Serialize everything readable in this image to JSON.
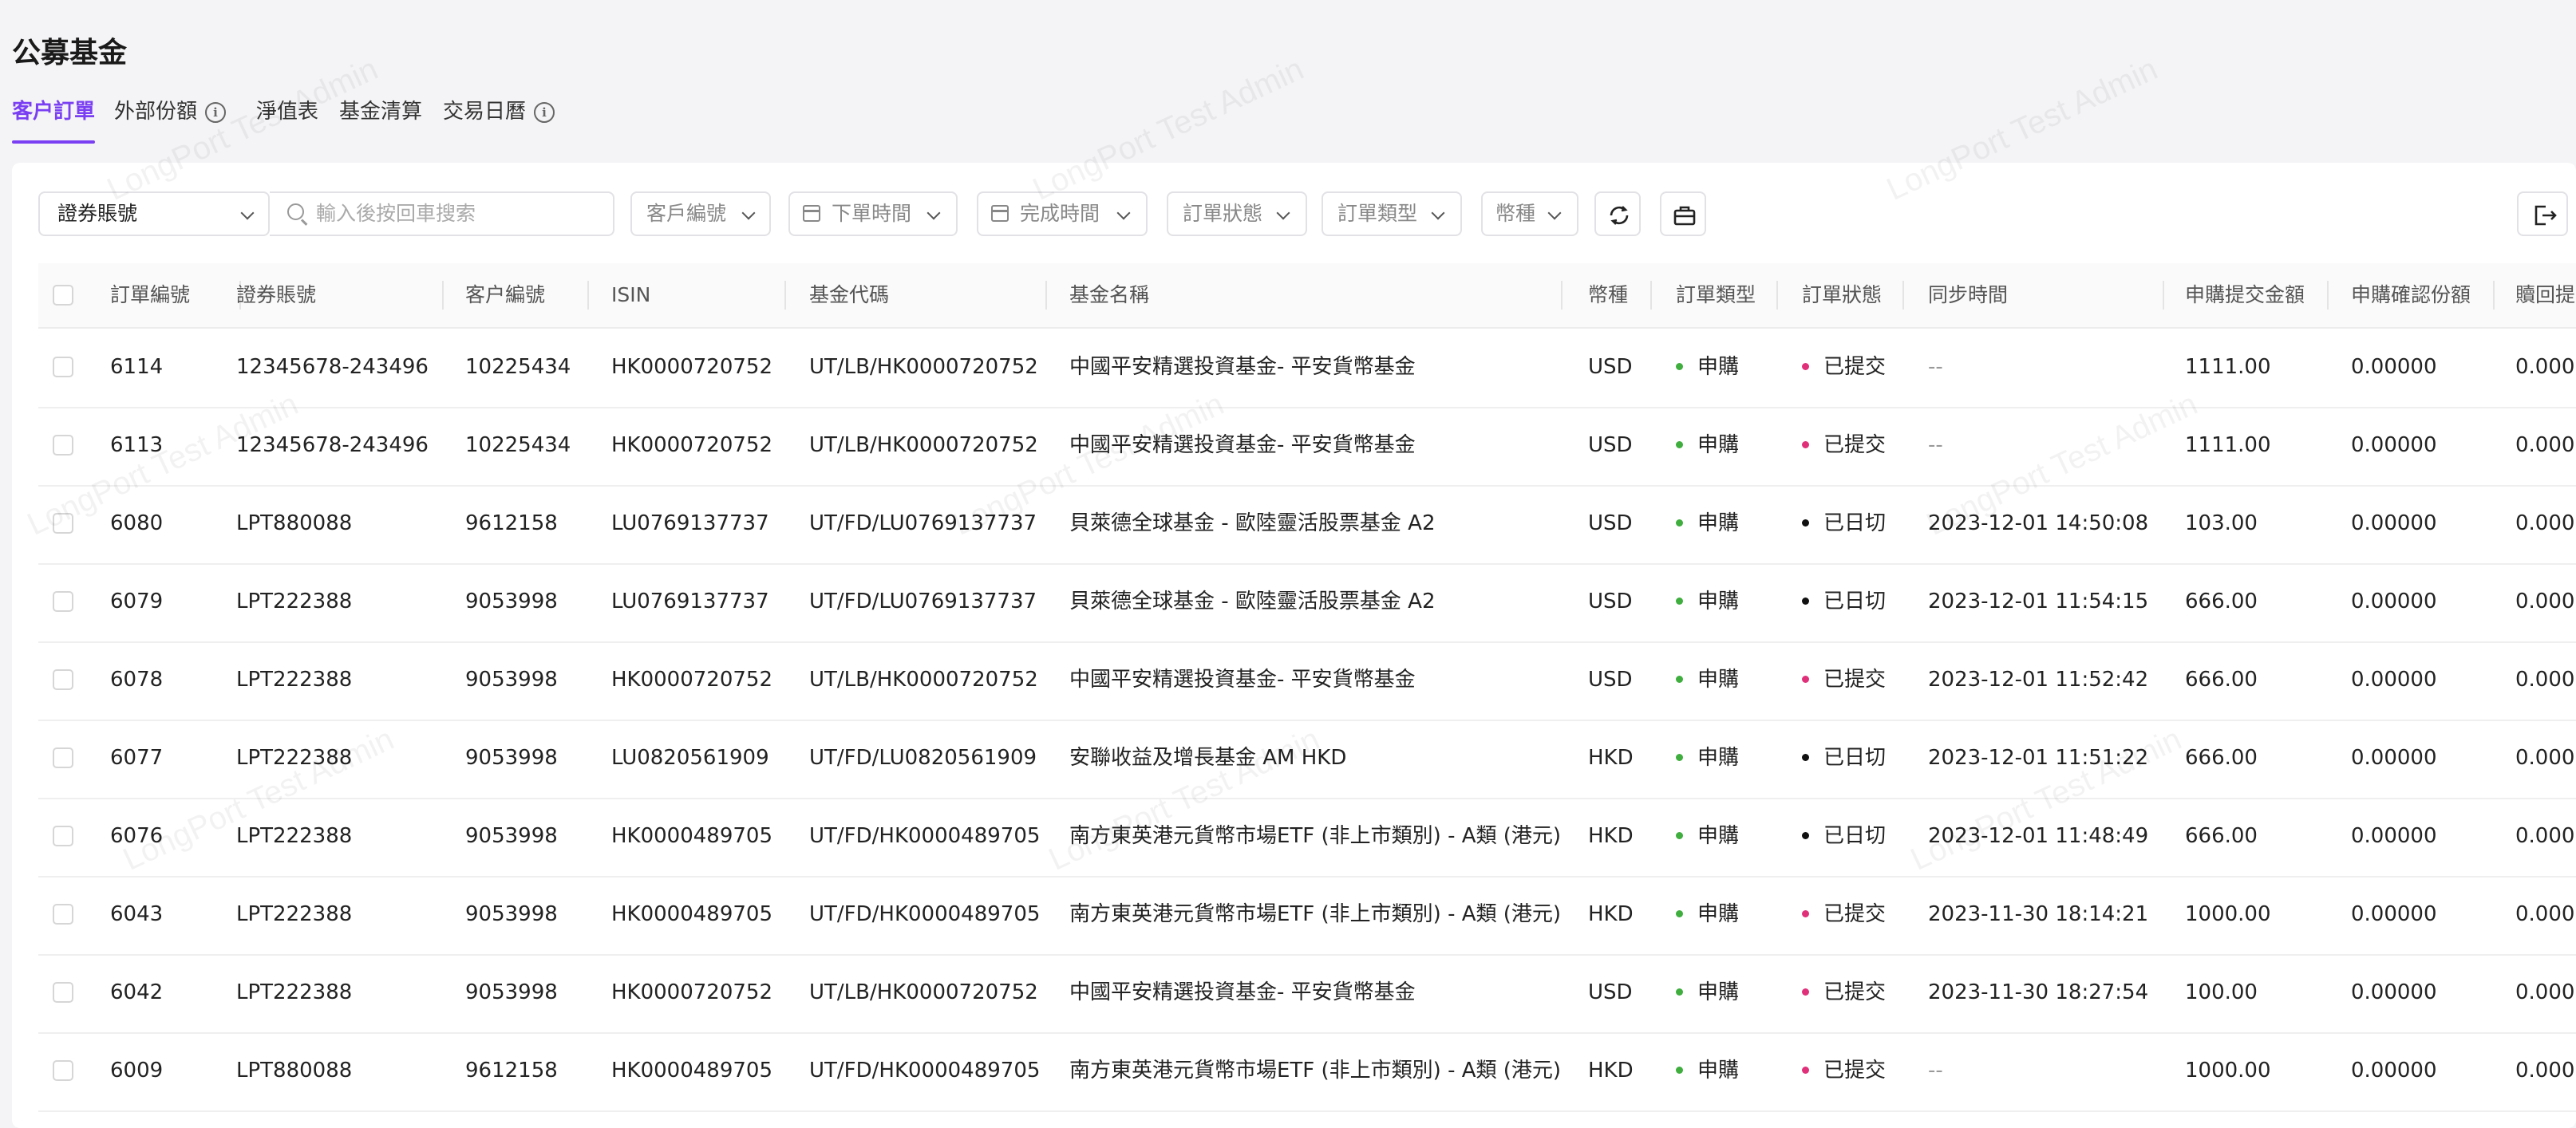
{
  "page": {
    "title": "公募基金"
  },
  "tabs": [
    {
      "label": "客户訂單",
      "active": true
    },
    {
      "label": "外部份額",
      "info": true
    },
    {
      "label": "淨值表"
    },
    {
      "label": "基金清算"
    },
    {
      "label": "交易日曆",
      "info": true
    }
  ],
  "filters": {
    "account_select": "證券賬號",
    "search_placeholder": "輸入後按回車搜索",
    "customer_no": "客戶編號",
    "order_time": "下單時間",
    "complete_time": "完成時間",
    "order_status": "訂單狀態",
    "order_type": "訂單類型",
    "currency": "幣種"
  },
  "columns": [
    "訂單編號",
    "證券賬號",
    "客户編號",
    "ISIN",
    "基金代碼",
    "基金名稱",
    "幣種",
    "訂單類型",
    "訂單狀態",
    "同步時間",
    "申購提交金額",
    "申購確認份額",
    "贖回提"
  ],
  "status_colors": {
    "已提交": "#e0307a",
    "已日切": "#111111",
    "申購": "#3fae3f"
  },
  "accent_color": "#7a3ff2",
  "rows": [
    {
      "order_no": "6114",
      "account": "12345678-243496",
      "customer": "10225434",
      "isin": "HK0000720752",
      "fund_code": "UT/LB/HK0000720752",
      "fund_name": "中國平安精選投資基金- 平安貨幣基金",
      "currency": "USD",
      "type": "申購",
      "status": "已提交",
      "sync_time": "--",
      "amount": "1111.00",
      "confirmed": "0.00000",
      "redeem": "0.000"
    },
    {
      "order_no": "6113",
      "account": "12345678-243496",
      "customer": "10225434",
      "isin": "HK0000720752",
      "fund_code": "UT/LB/HK0000720752",
      "fund_name": "中國平安精選投資基金- 平安貨幣基金",
      "currency": "USD",
      "type": "申購",
      "status": "已提交",
      "sync_time": "--",
      "amount": "1111.00",
      "confirmed": "0.00000",
      "redeem": "0.000"
    },
    {
      "order_no": "6080",
      "account": "LPT880088",
      "customer": "9612158",
      "isin": "LU0769137737",
      "fund_code": "UT/FD/LU0769137737",
      "fund_name": "貝萊德全球基金 - 歐陸靈活股票基金 A2",
      "currency": "USD",
      "type": "申購",
      "status": "已日切",
      "sync_time": "2023-12-01 14:50:08",
      "amount": "103.00",
      "confirmed": "0.00000",
      "redeem": "0.000"
    },
    {
      "order_no": "6079",
      "account": "LPT222388",
      "customer": "9053998",
      "isin": "LU0769137737",
      "fund_code": "UT/FD/LU0769137737",
      "fund_name": "貝萊德全球基金 - 歐陸靈活股票基金 A2",
      "currency": "USD",
      "type": "申購",
      "status": "已日切",
      "sync_time": "2023-12-01 11:54:15",
      "amount": "666.00",
      "confirmed": "0.00000",
      "redeem": "0.000"
    },
    {
      "order_no": "6078",
      "account": "LPT222388",
      "customer": "9053998",
      "isin": "HK0000720752",
      "fund_code": "UT/LB/HK0000720752",
      "fund_name": "中國平安精選投資基金- 平安貨幣基金",
      "currency": "USD",
      "type": "申購",
      "status": "已提交",
      "sync_time": "2023-12-01 11:52:42",
      "amount": "666.00",
      "confirmed": "0.00000",
      "redeem": "0.000"
    },
    {
      "order_no": "6077",
      "account": "LPT222388",
      "customer": "9053998",
      "isin": "LU0820561909",
      "fund_code": "UT/FD/LU0820561909",
      "fund_name": "安聯收益及增長基金 AM HKD",
      "currency": "HKD",
      "type": "申購",
      "status": "已日切",
      "sync_time": "2023-12-01 11:51:22",
      "amount": "666.00",
      "confirmed": "0.00000",
      "redeem": "0.000"
    },
    {
      "order_no": "6076",
      "account": "LPT222388",
      "customer": "9053998",
      "isin": "HK0000489705",
      "fund_code": "UT/FD/HK0000489705",
      "fund_name": "南方東英港元貨幣市場ETF (非上市類別) - A類 (港元)",
      "currency": "HKD",
      "type": "申購",
      "status": "已日切",
      "sync_time": "2023-12-01 11:48:49",
      "amount": "666.00",
      "confirmed": "0.00000",
      "redeem": "0.000"
    },
    {
      "order_no": "6043",
      "account": "LPT222388",
      "customer": "9053998",
      "isin": "HK0000489705",
      "fund_code": "UT/FD/HK0000489705",
      "fund_name": "南方東英港元貨幣市場ETF (非上市類別) - A類 (港元)",
      "currency": "HKD",
      "type": "申購",
      "status": "已提交",
      "sync_time": "2023-11-30 18:14:21",
      "amount": "1000.00",
      "confirmed": "0.00000",
      "redeem": "0.000"
    },
    {
      "order_no": "6042",
      "account": "LPT222388",
      "customer": "9053998",
      "isin": "HK0000720752",
      "fund_code": "UT/LB/HK0000720752",
      "fund_name": "中國平安精選投資基金- 平安貨幣基金",
      "currency": "USD",
      "type": "申購",
      "status": "已提交",
      "sync_time": "2023-11-30 18:27:54",
      "amount": "100.00",
      "confirmed": "0.00000",
      "redeem": "0.000"
    },
    {
      "order_no": "6009",
      "account": "LPT880088",
      "customer": "9612158",
      "isin": "HK0000489705",
      "fund_code": "UT/FD/HK0000489705",
      "fund_name": "南方東英港元貨幣市場ETF (非上市類別) - A類 (港元)",
      "currency": "HKD",
      "type": "申購",
      "status": "已提交",
      "sync_time": "--",
      "amount": "1000.00",
      "confirmed": "0.00000",
      "redeem": "0.000"
    }
  ],
  "watermark_text": "LongPort Test Admin"
}
